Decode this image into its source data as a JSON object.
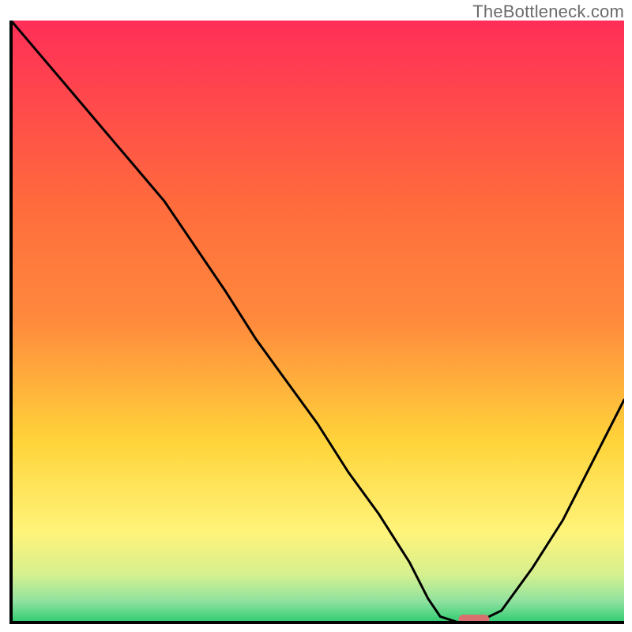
{
  "watermark": "TheBottleneck.com",
  "chart_data": {
    "type": "line",
    "title": "",
    "xlabel": "",
    "ylabel": "",
    "xlim": [
      0,
      1
    ],
    "ylim": [
      0,
      1
    ],
    "grid": false,
    "legend": false,
    "series": [
      {
        "name": "bottleneck-curve",
        "x": [
          0.0,
          0.05,
          0.1,
          0.15,
          0.2,
          0.25,
          0.29,
          0.35,
          0.4,
          0.45,
          0.5,
          0.55,
          0.6,
          0.65,
          0.68,
          0.7,
          0.73,
          0.76,
          0.8,
          0.85,
          0.9,
          0.95,
          1.0
        ],
        "values": [
          1.0,
          0.94,
          0.88,
          0.82,
          0.76,
          0.7,
          0.64,
          0.55,
          0.47,
          0.4,
          0.33,
          0.25,
          0.18,
          0.1,
          0.04,
          0.01,
          0.0,
          0.0,
          0.02,
          0.09,
          0.17,
          0.27,
          0.37
        ]
      }
    ],
    "marker": {
      "name": "highlight-segment",
      "x_start": 0.73,
      "x_end": 0.78,
      "y": 0.0,
      "color": "#d97070"
    },
    "background_gradient": {
      "top": "#ff2e58",
      "mid1": "#ff8a3d",
      "mid2": "#ffd43a",
      "mid3": "#fff47a",
      "mid4": "#d6f08f",
      "bottom": "#2ecc71"
    },
    "axis_color": "#000000",
    "curve_color": "#000000"
  }
}
